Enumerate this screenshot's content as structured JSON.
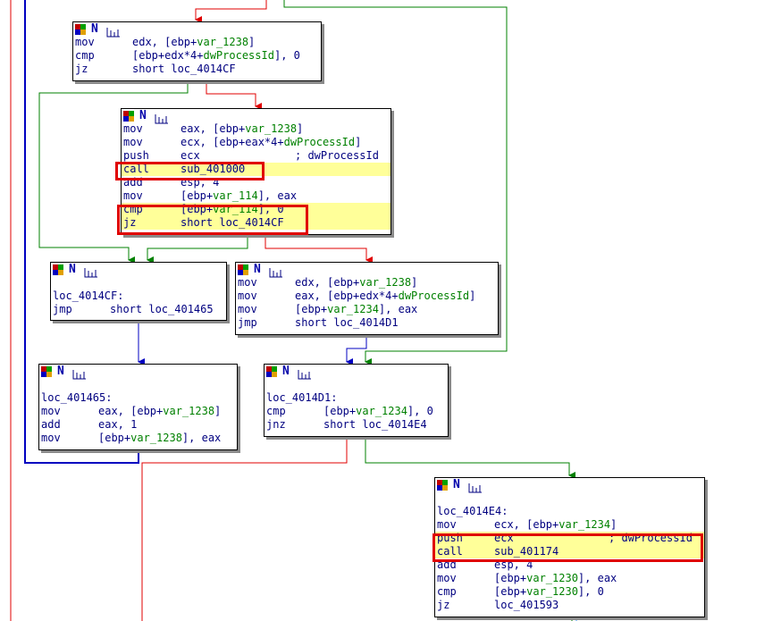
{
  "node_a": {
    "icons": [
      "graph-color-icon",
      "n-icon",
      "graph-view-icon"
    ],
    "lines": [
      {
        "m": "mov",
        "a": "edx, [ebp+",
        "v": "var_1238",
        "b": "]"
      },
      {
        "m": "cmp",
        "a": "[ebp+edx*4+",
        "v": "dwProcessId",
        "b": "], 0"
      },
      {
        "m": "jz",
        "a": "short loc_4014CF",
        "v": "",
        "b": ""
      }
    ]
  },
  "node_b": {
    "lines": [
      {
        "m": "mov",
        "a": "eax, [ebp+",
        "v": "var_1238",
        "b": "]"
      },
      {
        "m": "mov",
        "a": "ecx, [ebp+eax*4+",
        "v": "dwProcessId",
        "b": "]"
      },
      {
        "m": "push",
        "a": "ecx",
        "v": "",
        "b": "",
        "c": "; dwProcessId"
      },
      {
        "m": "call",
        "a": "sub_401000",
        "v": "",
        "b": ""
      },
      {
        "m": "add",
        "a": "esp, 4",
        "v": "",
        "b": ""
      },
      {
        "m": "mov",
        "a": "[ebp+",
        "v": "var_114",
        "b": "], eax"
      },
      {
        "m": "cmp",
        "a": "[ebp+",
        "v": "var_114",
        "b": "], 0"
      },
      {
        "m": "jz",
        "a": "short loc_4014CF",
        "v": "",
        "b": ""
      }
    ]
  },
  "node_c": {
    "label": "loc_4014CF:",
    "lines": [
      {
        "m": "jmp",
        "a": "short loc_401465",
        "v": "",
        "b": ""
      }
    ]
  },
  "node_d": {
    "lines": [
      {
        "m": "mov",
        "a": "edx, [ebp+",
        "v": "var_1238",
        "b": "]"
      },
      {
        "m": "mov",
        "a": "eax, [ebp+edx*4+",
        "v": "dwProcessId",
        "b": "]"
      },
      {
        "m": "mov",
        "a": "[ebp+",
        "v": "var_1234",
        "b": "], eax"
      },
      {
        "m": "jmp",
        "a": "short loc_4014D1",
        "v": "",
        "b": ""
      }
    ]
  },
  "node_e": {
    "label": "loc_401465:",
    "lines": [
      {
        "m": "mov",
        "a": "eax, [ebp+",
        "v": "var_1238",
        "b": "]"
      },
      {
        "m": "add",
        "a": "eax, 1",
        "v": "",
        "b": ""
      },
      {
        "m": "mov",
        "a": "[ebp+",
        "v": "var_1238",
        "b": "], eax"
      }
    ]
  },
  "node_f": {
    "label": "loc_4014D1:",
    "lines": [
      {
        "m": "cmp",
        "a": "[ebp+",
        "v": "var_1234",
        "b": "], 0"
      },
      {
        "m": "jnz",
        "a": "short loc_4014E4",
        "v": "",
        "b": ""
      }
    ]
  },
  "node_g": {
    "label": "loc_4014E4:",
    "lines": [
      {
        "m": "mov",
        "a": "ecx, [ebp+",
        "v": "var_1234",
        "b": "]"
      },
      {
        "m": "push",
        "a": "ecx",
        "v": "",
        "b": "",
        "c": "; dwProcessId"
      },
      {
        "m": "call",
        "a": "sub_401174",
        "v": "",
        "b": ""
      },
      {
        "m": "add",
        "a": "esp, 4",
        "v": "",
        "b": ""
      },
      {
        "m": "mov",
        "a": "[ebp+",
        "v": "var_1230",
        "b": "], eax"
      },
      {
        "m": "cmp",
        "a": "[ebp+",
        "v": "var_1230",
        "b": "], 0"
      },
      {
        "m": "jz",
        "a": "loc_401593",
        "v": "",
        "b": ""
      }
    ]
  },
  "colors": {
    "true_edge": "#008000",
    "false_edge": "#e00000",
    "uncond_edge": "#0000c0",
    "highlight": "#ffff99",
    "box": "#e00000"
  }
}
